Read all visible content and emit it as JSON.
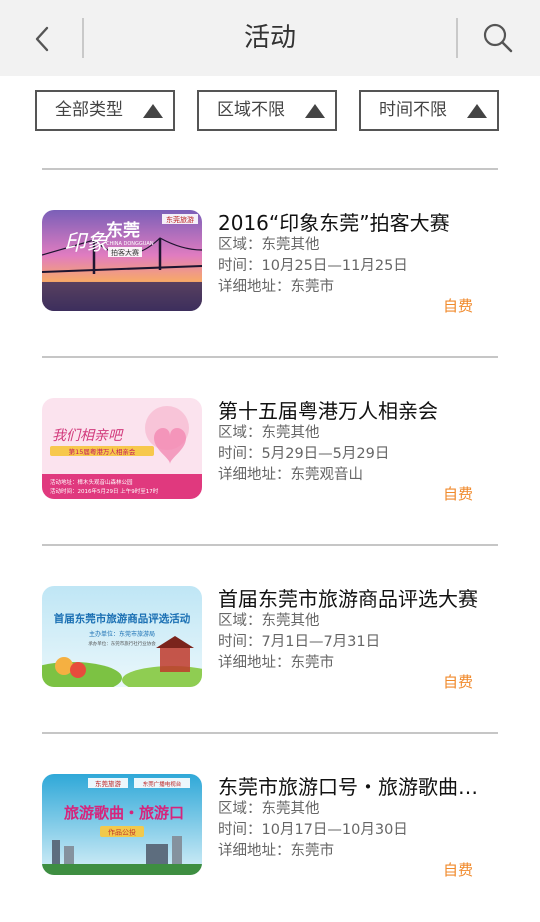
{
  "header": {
    "title": "活动"
  },
  "filters": [
    {
      "label": "全部类型"
    },
    {
      "label": "区域不限"
    },
    {
      "label": "时间不限"
    }
  ],
  "labels": {
    "region": "区域：",
    "time": "时间：",
    "address": "详细地址："
  },
  "events": [
    {
      "title": "2016“印象东莞”拍客大赛",
      "region": "东莞其他",
      "time": "10月25日—11月25日",
      "address": "东莞市",
      "price": "自费",
      "thumb": {
        "main_text": "东莞",
        "sub_text": "CHINA DONGGUAN",
        "tag": "拍客大赛",
        "art_text": "印象",
        "brand": "东莞旅游"
      }
    },
    {
      "title": "第十五届粤港万人相亲会",
      "region": "东莞其他",
      "time": "5月29日—5月29日",
      "address": "东莞观音山",
      "price": "自费",
      "thumb": {
        "main_text": "我们相亲吧",
        "sub_text": "第15届粤港万人相亲会",
        "line1": "活动地址：樟木头观音山森林公园",
        "line2": "活动时间：2016年5月29日  上午9时至17时"
      }
    },
    {
      "title": "首届东莞市旅游商品评选大赛",
      "region": "东莞其他",
      "time": "7月1日—7月31日",
      "address": "东莞市",
      "price": "自费",
      "thumb": {
        "main_text": "首届东莞市旅游商品评选活动",
        "sub_text": "主办单位：东莞市旅游局",
        "line1": "承办单位：东莞市旅行社行业协会"
      }
    },
    {
      "title": "东莞市旅游口号・旅游歌曲…",
      "region": "东莞其他",
      "time": "10月17日—10月30日",
      "address": "东莞市",
      "price": "自费",
      "thumb": {
        "main_text": "旅游歌曲・旅游口",
        "sub_text": "作品公投",
        "brand": "东莞旅游",
        "brand2": "东莞广播电视台"
      }
    }
  ],
  "colors": {
    "accent_price": "#f08a2c",
    "header_bg": "#f2f2f2",
    "divider": "#c6c6c6"
  }
}
